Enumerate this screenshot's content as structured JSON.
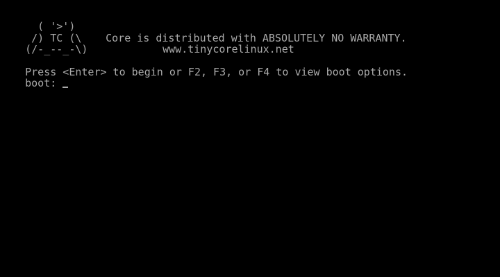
{
  "logo": {
    "line1": "  ( '>')",
    "line2": " /) TC (\\",
    "line3": "(/-_--_-\\)"
  },
  "banner": {
    "warranty": "Core is distributed with ABSOLUTELY NO WARRANTY.",
    "website": "www.tinycorelinux.net"
  },
  "boot": {
    "instructions": "Press <Enter> to begin or F2, F3, or F4 to view boot options.",
    "prompt": "boot: "
  },
  "colors": {
    "background": "#000000",
    "text": "#aaaaaa"
  }
}
